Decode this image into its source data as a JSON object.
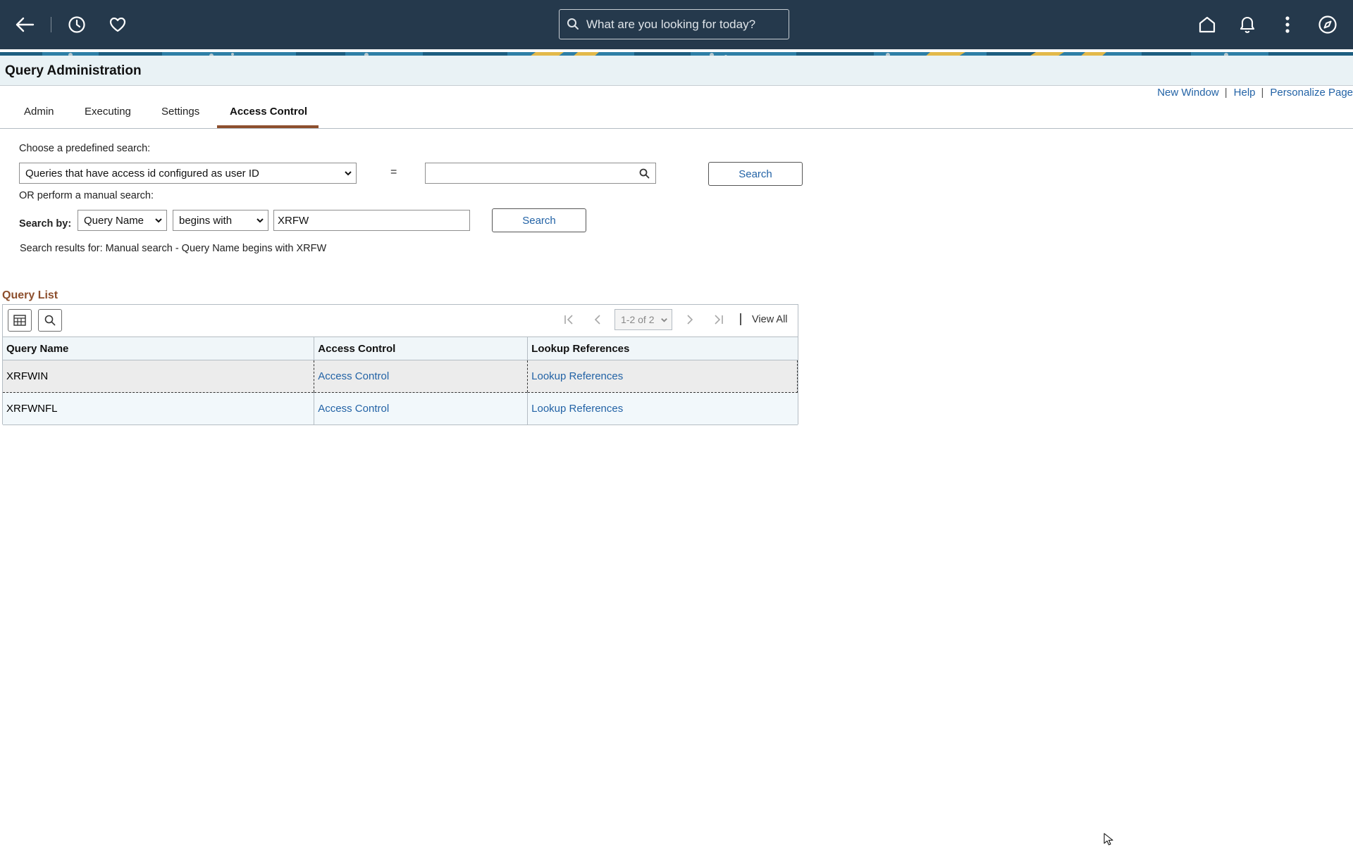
{
  "header": {
    "search_placeholder": "What are you looking for today?",
    "icons": [
      "back-icon",
      "history-icon",
      "favorites-icon",
      "home-icon",
      "notifications-icon",
      "more-icon",
      "navigator-icon"
    ]
  },
  "page": {
    "title": "Query Administration",
    "links": [
      "New Window",
      "Help",
      "Personalize Page"
    ]
  },
  "tabs": [
    {
      "label": "Admin",
      "active": false
    },
    {
      "label": "Executing",
      "active": false
    },
    {
      "label": "Settings",
      "active": false
    },
    {
      "label": "Access Control",
      "active": true
    }
  ],
  "predefined": {
    "label": "Choose a predefined search:",
    "selected": "Queries that have access id configured as user ID",
    "equals": "=",
    "value": "",
    "button": "Search"
  },
  "manual": {
    "or_label": "OR perform a manual search:",
    "search_by_label": "Search by:",
    "field": "Query Name",
    "operator": "begins with",
    "value": "XRFW",
    "button": "Search"
  },
  "results_text": "Search results for: Manual search - Query Name begins with XRFW",
  "grid": {
    "title": "Query List",
    "pager": "1-2 of 2",
    "view_all": "View All",
    "columns": [
      "Query Name",
      "Access Control",
      "Lookup References"
    ],
    "rows": [
      {
        "query_name": "XRFWIN",
        "access_control": "Access Control",
        "lookup": "Lookup References"
      },
      {
        "query_name": "XRFWNFL",
        "access_control": "Access Control",
        "lookup": "Lookup References"
      }
    ]
  },
  "colors": {
    "header_bg": "#25394c",
    "accent": "#8d4f2d",
    "link": "#2363a6"
  }
}
